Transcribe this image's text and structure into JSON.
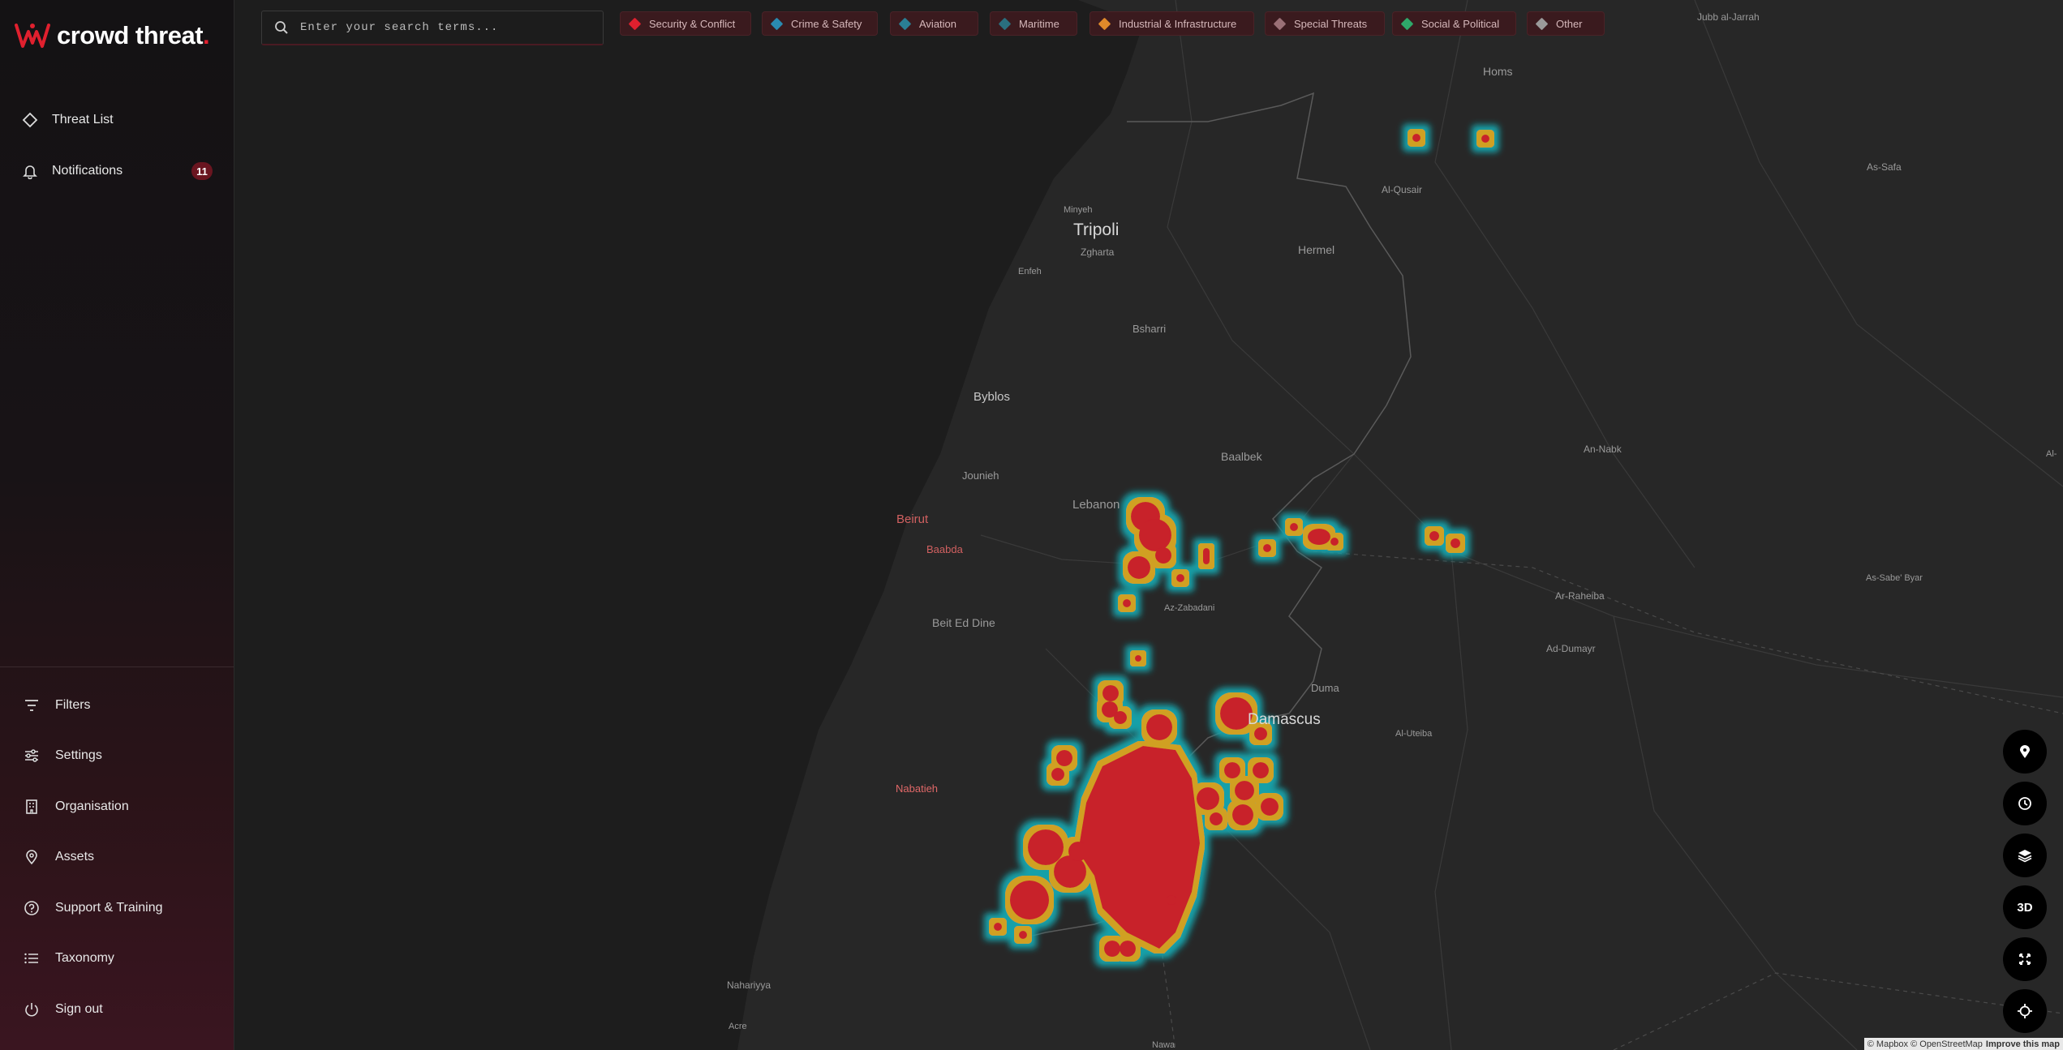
{
  "brand": {
    "name": "crowd threat",
    "dot": "."
  },
  "nav": {
    "threat_list": "Threat List",
    "notifications": "Notifications",
    "notifications_count": "11"
  },
  "bottom_nav": {
    "filters": "Filters",
    "settings": "Settings",
    "organisation": "Organisation",
    "assets": "Assets",
    "support": "Support & Training",
    "taxonomy": "Taxonomy",
    "sign_out": "Sign out"
  },
  "search": {
    "placeholder": "Enter your search terms..."
  },
  "categories": [
    {
      "label": "Security & Conflict",
      "color": "#e0202e"
    },
    {
      "label": "Crime & Safety",
      "color": "#2a8ab0"
    },
    {
      "label": "Aviation",
      "color": "#2a7f95"
    },
    {
      "label": "Maritime",
      "color": "#2a6f7f"
    },
    {
      "label": "Industrial & Infrastructure",
      "color": "#e08a2a"
    },
    {
      "label": "Special Threats",
      "color": "#9a7076"
    },
    {
      "label": "Social & Political",
      "color": "#2ea86a"
    },
    {
      "label": "Other",
      "color": "#9a9a9a"
    }
  ],
  "map_controls": {
    "pin": "pin-icon",
    "clock": "clock-icon",
    "layers": "layers-icon",
    "three_d": "3D",
    "fullscreen": "expand-icon",
    "locate": "crosshair-icon"
  },
  "map_labels": {
    "tripoli": "Tripoli",
    "byblos": "Byblos",
    "jounieh": "Jounieh",
    "lebanon": "Lebanon",
    "beirut": "Beirut",
    "baabda": "Baabda",
    "beit_ed_dine": "Beit Ed Dine",
    "nabatieh": "Nabatieh",
    "damascus": "Damascus",
    "duma": "Duma",
    "homs": "Homs",
    "hermel": "Hermel",
    "baalbek": "Baalbek",
    "bsharri": "Bsharri",
    "zgharta": "Zgharta",
    "minyeh": "Minyeh",
    "enfeh": "Enfeh",
    "al_qusair": "Al-Qusair",
    "as_safa": "As-Safa",
    "jubb_al_jarrah": "Jubb al-Jarrah",
    "an_nabk": "An-Nabk",
    "ar_raheiba": "Ar-Raheiba",
    "ad_dumayr": "Ad-Dumayr",
    "al_uteiba": "Al-Uteiba",
    "az_zabadani": "Az-Zabadani",
    "as_sabe_byar": "As-Sabe' Byar",
    "nahariyya": "Nahariyya",
    "acre": "Acre",
    "nawa": "Nawa",
    "al_edge": "Al-"
  },
  "attribution": {
    "text": "© Mapbox © OpenStreetMap",
    "improve": "Improve this map"
  }
}
